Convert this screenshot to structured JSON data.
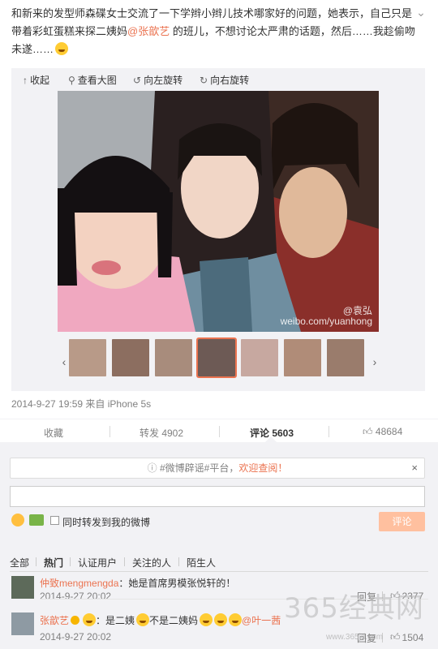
{
  "post": {
    "text_part1": "和新来的发型师森碟女士交流了一下学辫小辫儿技术哪家好的问题，她表示，自己只是带着彩虹蛋糕来探二姨妈",
    "mention": "@张歆艺",
    "text_part2": " 的班儿，不想讨论太严肃的话题，然后……我趁偷吻未遂……"
  },
  "media_toolbar": {
    "collapse": "收起",
    "view_large": "查看大图",
    "rotate_left": "向左旋转",
    "rotate_right": "向右旋转"
  },
  "photo": {
    "watermark_top": "@袁弘",
    "watermark_bottom": "weibo.com/yuanhong"
  },
  "meta": {
    "timestamp": "2014-9-27 19:59",
    "source": "来自 iPhone 5s"
  },
  "actions": {
    "favorite": "收藏",
    "repost": "转发 4902",
    "comment": "评论 5603",
    "like": "48684"
  },
  "comment_box": {
    "notice_prefix": "#微博辟谣#平台，",
    "notice_link": "欢迎查阅！",
    "notice_close": "×",
    "repost_checkbox_label": "同时转发到我的微博",
    "submit": "评论"
  },
  "filters": {
    "all": "全部",
    "hot": "热门",
    "verified": "认证用户",
    "following": "关注的人",
    "stranger": "陌生人"
  },
  "comments": [
    {
      "user": "仲致mengmengda",
      "text": "：她是首席男模张悦轩的！",
      "reply": "回复",
      "likes": "2377"
    },
    {
      "user": "张歆艺",
      "text_a": "：是二姨",
      "text_b": "不是二姨妈",
      "mention": "@叶一茜",
      "time": "2014-9-27 20:02",
      "reply": "回复",
      "likes": "1504"
    }
  ],
  "first_comment_time": "2014-9-27 20:02",
  "site_watermark": "365经典网",
  "site_watermark_url": "www.365jd.com",
  "colors": {
    "accent": "#eb7350",
    "muted": "#808080",
    "panel": "#f2f2f5"
  }
}
